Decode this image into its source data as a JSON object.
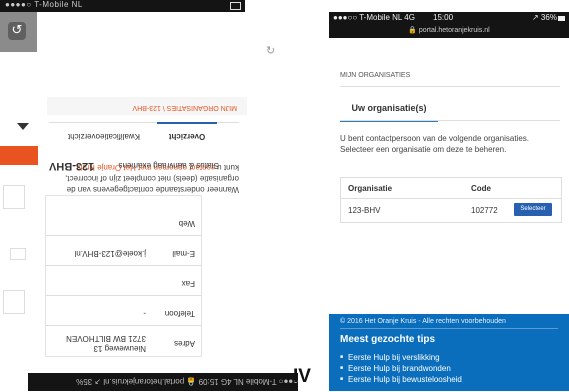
{
  "left_phone": {
    "status_text": "●●●●○ T-Mobile NL",
    "back_icon": "return-arrow-icon",
    "refresh_icon": "refresh-icon",
    "breadcrumb": "MIJN ORGANISATIES  \\  123-BHV",
    "title": "123-BHV",
    "subtitle": "Status & aanvraag examens",
    "tabs": [
      "Overzicht",
      "Kwalificatieoverzicht"
    ],
    "notice": "Wanneer onderstaande contactgegevens van de organisatie (deels) niet compleet zijn of incorrect, kunt u ",
    "notice_link": "contact opnemen met Het Oranje Kruis.",
    "info": [
      {
        "label": "Adres",
        "value": "Nieuweweg 13\n3721 BW BILTHOVEN"
      },
      {
        "label": "Telefoon",
        "value": "-"
      },
      {
        "label": "Fax",
        "value": ""
      },
      {
        "label": "E-mail",
        "value": "j.koele@123-BHV.nl"
      },
      {
        "label": "Web",
        "value": ""
      }
    ],
    "bottom_status": "●●●○ T-Mobile NL  4G   15:09   🔒 portal.hetoranjekruis.nl   ↗ 35%",
    "hv_fragment": "IV"
  },
  "right_phone": {
    "carrier": "●●●○○ T-Mobile NL  4G",
    "time": "15:00",
    "battery": "↗ 36%",
    "url": "🔒 portal.hetoranjekruis.nl",
    "section_title": "MIJN ORGANISATIES",
    "tab_label": "Uw organisatie(s)",
    "intro": "U bent contactpersoon van de volgende organisaties. Selecteer een organisatie om deze te beheren.",
    "table": {
      "headers": [
        "Organisatie",
        "Code"
      ],
      "rows": [
        {
          "organisatie": "123-BHV",
          "code": "102772",
          "action": "Selecteer"
        }
      ]
    },
    "footer": {
      "copyright": "© 2016 Het Oranje Kruis - Alle rechten voorbehouden",
      "tips_title": "Meest gezochte tips",
      "tips": [
        "Eerste Hulp bij verslikking",
        "Eerste Hulp bij brandwonden",
        "Eerste Hulp bij bewusteloosheid"
      ]
    }
  },
  "colors": {
    "accent_orange": "#e8531f",
    "accent_blue": "#2860b0",
    "footer_blue": "#0a6ebd"
  }
}
